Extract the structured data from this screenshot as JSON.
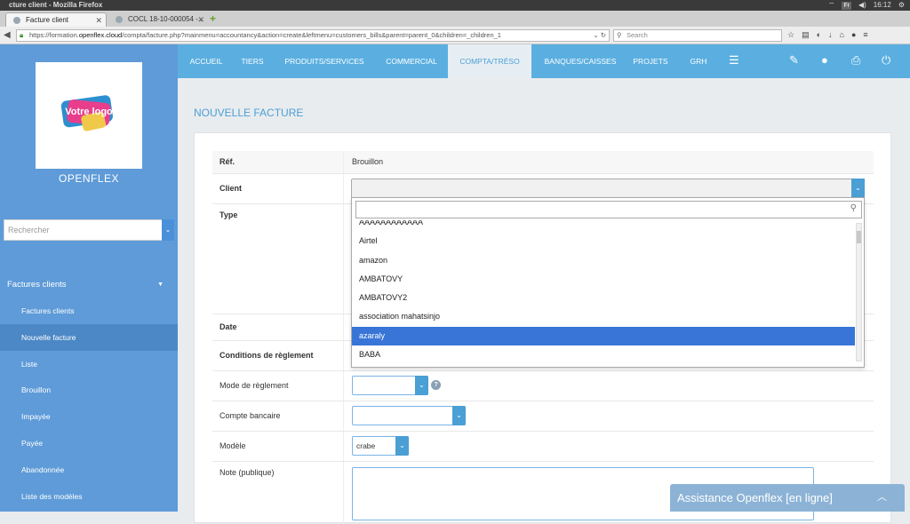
{
  "os": {
    "window_title": "cture client - Mozilla Firefox",
    "lang": "Fr",
    "clock": "16:12"
  },
  "browser": {
    "tabs": [
      {
        "label": "Facture client"
      },
      {
        "label": "COCL 18-10-000054 -..."
      }
    ],
    "url_prefix": "https://formation.",
    "url_host": "openflex.cloud",
    "url_path": "/compta/facture.php?mainmenu=accountancy&action=create&leftmenu=customers_bills&parent=parent_0&children=_children_1",
    "search_placeholder": "Search"
  },
  "sidebar": {
    "logo_text": "Votre logo",
    "brand": "OPENFLEX",
    "search_placeholder": "Rechercher",
    "section": "Factures clients",
    "items": [
      {
        "label": "Factures clients"
      },
      {
        "label": "Nouvelle facture"
      },
      {
        "label": "Liste"
      },
      {
        "label": "Brouillon"
      },
      {
        "label": "Impayée"
      },
      {
        "label": "Payée"
      },
      {
        "label": "Abandonnée"
      },
      {
        "label": "Liste des modèles"
      }
    ]
  },
  "topnav": {
    "items": [
      {
        "label": "ACCUEIL"
      },
      {
        "label": "TIERS"
      },
      {
        "label": "PRODUITS/SERVICES"
      },
      {
        "label": "COMMERCIAL"
      },
      {
        "label": "COMPTA/TRÉSO"
      },
      {
        "label": "BANQUES/CAISSES"
      },
      {
        "label": "PROJETS"
      },
      {
        "label": "GRH"
      }
    ]
  },
  "page": {
    "title": "NOUVELLE FACTURE",
    "fields": {
      "ref_label": "Réf.",
      "ref_value": "Brouillon",
      "client_label": "Client",
      "type_label": "Type",
      "date_label": "Date",
      "conditions_label": "Conditions de règlement",
      "mode_label": "Mode de règlement",
      "compte_label": "Compte bancaire",
      "modele_label": "Modèle",
      "modele_value": "crabe",
      "note_label": "Note (publique)"
    },
    "client_dropdown": {
      "options": [
        {
          "label": "AAAAAAAAAAAA"
        },
        {
          "label": "Airtel"
        },
        {
          "label": "amazon"
        },
        {
          "label": "AMBATOVY"
        },
        {
          "label": "AMBATOVY2"
        },
        {
          "label": "association mahatsinjo"
        },
        {
          "label": "azaraly"
        },
        {
          "label": "BABA"
        }
      ],
      "highlighted": "azaraly"
    }
  },
  "chat": {
    "label": "Assistance Openflex [en ligne]"
  },
  "colors": {
    "accent": "#5aafe0",
    "sidebar": "#5e9bd8",
    "highlight": "#3875d7"
  }
}
